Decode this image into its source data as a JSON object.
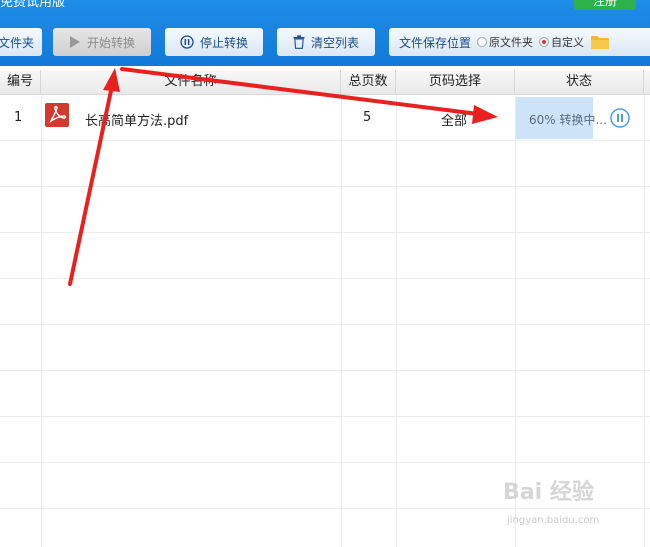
{
  "app": {
    "title": "免费试用版",
    "register_label": "注册"
  },
  "toolbar": {
    "add_folder_label": "文件夹",
    "start_label": "开始转换",
    "stop_label": "停止转换",
    "clear_label": "清空列表",
    "save_location_label": "文件保存位置",
    "radio_original": "原文件夹",
    "radio_custom": "自定义",
    "selected_option": "自定义"
  },
  "table": {
    "columns": [
      "编号",
      "文件名称",
      "总页数",
      "页码选择",
      "状态"
    ],
    "rows": [
      {
        "index": "1",
        "filename": "长高简单方法.pdf",
        "pages": "5",
        "page_range": "全部",
        "status": "60% 转换中...",
        "progress": 0.6
      }
    ]
  },
  "watermark": {
    "logo": "Bai 经验",
    "url": "jingyan.baidu.com"
  },
  "colors": {
    "topbar": "#1a84e2",
    "register_button": "#2bb34a",
    "annotation_arrow": "#e8201f",
    "pdf_icon": "#d03a2f",
    "status_fill": "#cde3f7"
  }
}
